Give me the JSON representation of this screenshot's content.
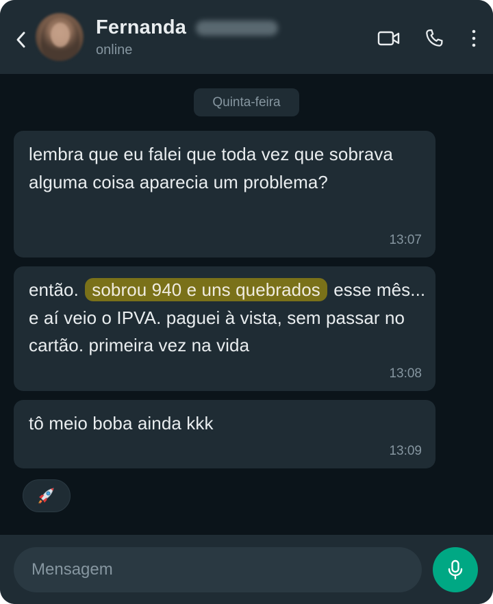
{
  "header": {
    "contact_name": "Fernanda",
    "status": "online",
    "icons": {
      "back": "chevron-left-icon",
      "video": "video-camera-icon",
      "call": "phone-icon",
      "menu": "more-vertical-icon"
    }
  },
  "chat": {
    "date_label": "Quinta-feira",
    "messages": [
      {
        "text": "lembra que eu falei que toda vez que sobrava alguma coisa aparecia um problema?",
        "time": "13:07"
      },
      {
        "text_before": "então.",
        "highlight": "sobrou 940 e uns quebrados",
        "text_after": "esse mês... e aí veio o IPVA. paguei à vista, sem passar no cartão. primeira vez na vida",
        "time": "13:08"
      },
      {
        "text": "tô meio boba ainda kkk",
        "time": "13:09"
      }
    ],
    "reaction": "🚀"
  },
  "composer": {
    "placeholder": "Mensagem",
    "mic_icon": "microphone-icon"
  },
  "colors": {
    "background": "#0b141a",
    "bar": "#1f2c34",
    "bubble": "#1f2c34",
    "highlight": "#7a7119",
    "accent": "#00a884",
    "secondary_text": "#8696a0",
    "primary_text": "#e9edef"
  }
}
